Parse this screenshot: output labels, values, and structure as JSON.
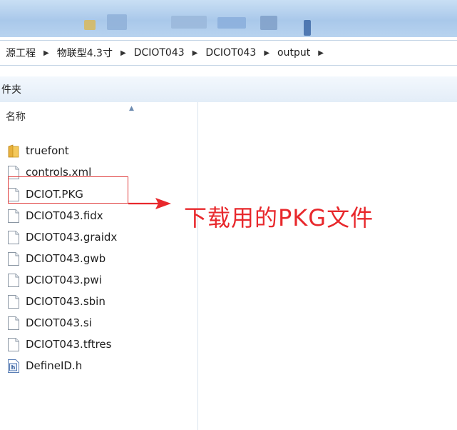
{
  "breadcrumb": {
    "items": [
      "源工程",
      "物联型4.3寸",
      "DCIOT043",
      "DCIOT043",
      "output"
    ]
  },
  "toolbar": {
    "new_folder_label": "件夹"
  },
  "list_header": {
    "name_label": "名称"
  },
  "files": [
    {
      "name": "truefont",
      "icon": "folder-icon"
    },
    {
      "name": "controls.xml",
      "icon": "document-icon"
    },
    {
      "name": "DCIOT.PKG",
      "icon": "document-icon"
    },
    {
      "name": "DCIOT043.fidx",
      "icon": "document-icon"
    },
    {
      "name": "DCIOT043.graidx",
      "icon": "document-icon"
    },
    {
      "name": "DCIOT043.gwb",
      "icon": "document-icon"
    },
    {
      "name": "DCIOT043.pwi",
      "icon": "document-icon"
    },
    {
      "name": "DCIOT043.sbin",
      "icon": "document-icon"
    },
    {
      "name": "DCIOT043.si",
      "icon": "document-icon"
    },
    {
      "name": "DCIOT043.tftres",
      "icon": "document-icon"
    },
    {
      "name": "DefineID.h",
      "icon": "header-file-icon"
    }
  ],
  "annotation": {
    "text": "下载用的PKG文件",
    "color": "#e8282c"
  }
}
